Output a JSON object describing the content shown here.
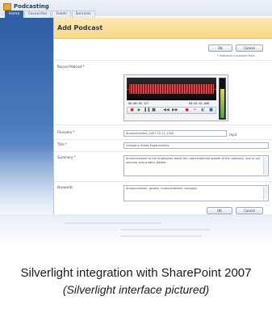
{
  "app": {
    "title": "Podcasting",
    "tabs": [
      "Home",
      "Favourites",
      "Feeds",
      "Services"
    ]
  },
  "dialog": {
    "title": "Add Podcast",
    "ok_label": "OK",
    "cancel_label": "Cancel",
    "required_note": "* Indicates a required field",
    "fields": {
      "record_label": "Record Podcast *",
      "filename_label": "Filename *",
      "filename_value": "Announcement_2007-10-11_1500",
      "filename_ext": ".mp3",
      "title_label": "Title *",
      "title_value": "Company Grows Exponentially",
      "summary_label": "Summary *",
      "summary_value": "Announcement to the employees about the unprecedented growth of the company, due to our services and product basket.",
      "keywords_label": "Keywords",
      "keywords_value": "Announcement, growth, unprecedented, company"
    },
    "recorder": {
      "time_elapsed": "00:00:05.127",
      "time_total": "00:02:01.000",
      "level": 0.72
    }
  },
  "caption": {
    "line1": "Silverlight integration with SharePoint 2007",
    "line2": "(Silverlight interface pictured)"
  },
  "colors": {
    "sidebar": "#2e5ea3",
    "header": "#f8d883",
    "accent": "#2f63a4"
  }
}
